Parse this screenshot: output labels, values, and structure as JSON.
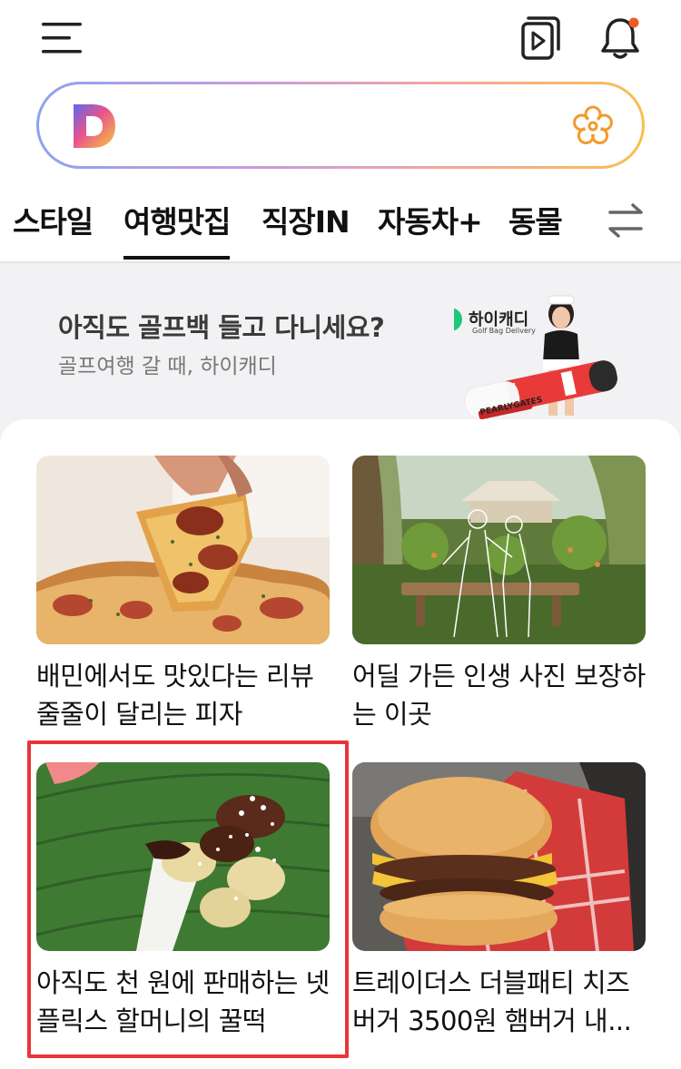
{
  "tabs": [
    {
      "label": "스타일"
    },
    {
      "label": "여행맛집"
    },
    {
      "label": "직장IN"
    },
    {
      "label": "자동차+"
    },
    {
      "label": "동물"
    }
  ],
  "active_tab": "여행맛집",
  "search": {
    "value": ""
  },
  "ad": {
    "title": "아직도 골프백 들고 다니세요?",
    "subtitle": "골프여행 갈 때, 하이캐디",
    "brand": "하이캐디",
    "brand_sub": "Golf Bag Delivery",
    "bag_text": "PEARLYGATES"
  },
  "articles": [
    {
      "title": "배민에서도 맛있다는 리뷰 줄줄이 달리는 피자",
      "icon": "pizza-photo"
    },
    {
      "title": "어딜 가든 인생 사진 보장하는 이곳",
      "icon": "garden-photo"
    },
    {
      "title": "아직도 천 원에 판매하는 넷플릭스 할머니의 꿀떡",
      "icon": "rice-cake-photo"
    },
    {
      "title": "트레이더스 더블패티 치즈버거 3500원 햄버거 내...",
      "icon": "burger-photo"
    }
  ],
  "colors": {
    "highlight": "#e8343a",
    "notification_dot": "#f05a24",
    "search_gradient": [
      "#8ea2f0",
      "#c79be0",
      "#f1a4a2",
      "#f8c050"
    ]
  }
}
